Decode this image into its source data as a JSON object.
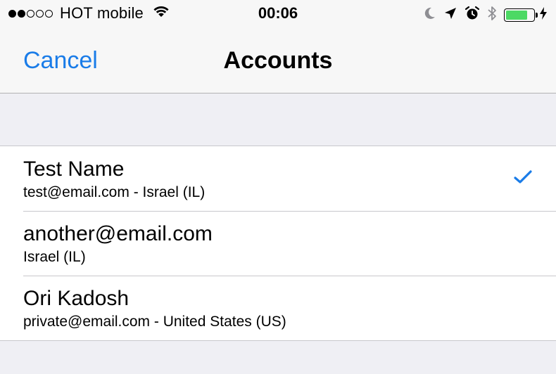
{
  "status_bar": {
    "signal_bars_filled": 2,
    "signal_bars_total": 5,
    "carrier": "HOT mobile",
    "time": "00:06",
    "icons": [
      "wifi-icon",
      "moon-icon",
      "location-arrow-icon",
      "alarm-icon",
      "bluetooth-icon",
      "battery-icon",
      "charging-bolt-icon"
    ],
    "battery_level": 0.8,
    "battery_color": "#4cd964"
  },
  "nav": {
    "cancel_label": "Cancel",
    "title": "Accounts",
    "accent_color": "#1a7ce8"
  },
  "accounts": [
    {
      "name": "Test Name",
      "detail": "test@email.com - Israel (IL)",
      "selected": true
    },
    {
      "name": "another@email.com",
      "detail": "Israel (IL)",
      "selected": false
    },
    {
      "name": "Ori Kadosh",
      "detail": "private@email.com - United States (US)",
      "selected": false
    }
  ]
}
